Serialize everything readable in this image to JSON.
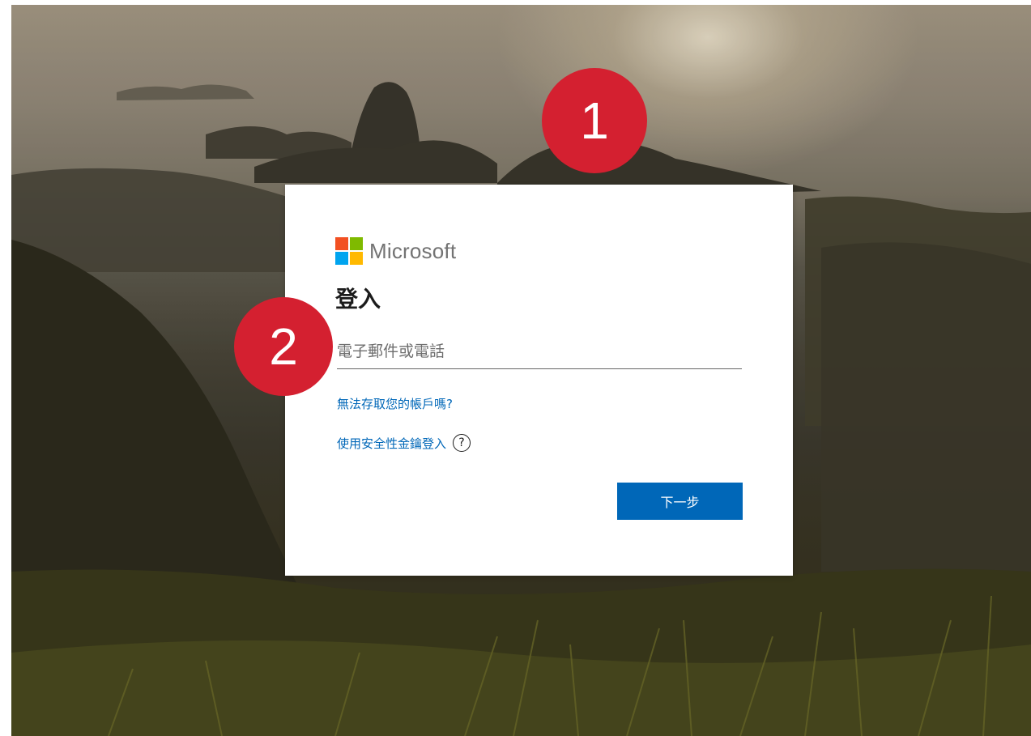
{
  "login": {
    "brand": "Microsoft",
    "title": "登入",
    "email_placeholder": "電子郵件或電話",
    "email_value": "",
    "cant_access_link": "無法存取您的帳戶嗎?",
    "security_key_link": "使用安全性金鑰登入",
    "help_icon_glyph": "?",
    "next_button": "下一步"
  },
  "annotations": {
    "badge_1": "1",
    "badge_2": "2"
  },
  "colors": {
    "ms_red": "#f25022",
    "ms_green": "#7fba00",
    "ms_blue": "#00a4ef",
    "ms_yellow": "#ffb900",
    "accent": "#0067b8",
    "badge": "#d42030"
  },
  "icons": {
    "logo": "microsoft-logo-icon",
    "help": "help-circle-icon"
  }
}
